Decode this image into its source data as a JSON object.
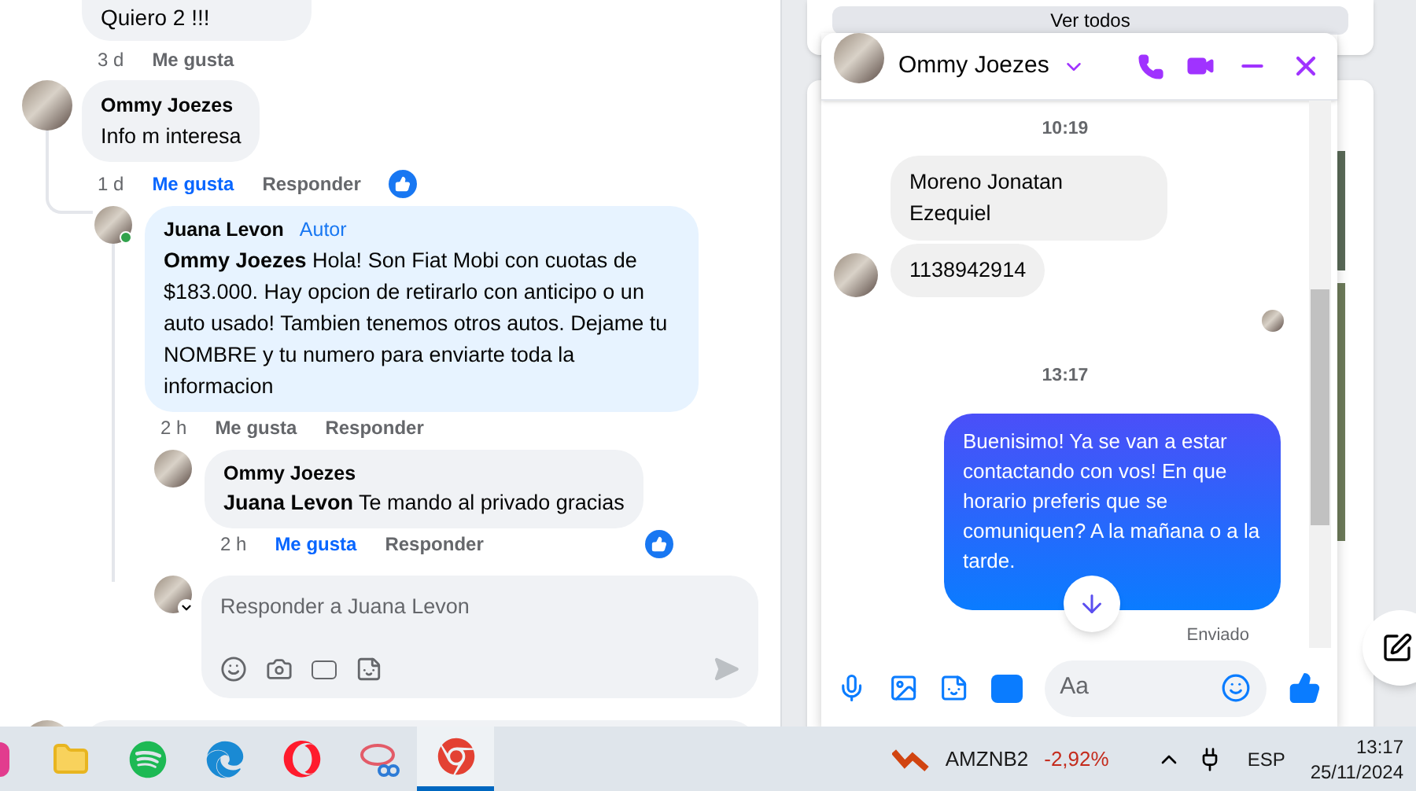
{
  "comment_thread": {
    "previous_comment": {
      "text": "Quiero 2 !!!",
      "time": "3 d",
      "like_label": "Me gusta",
      "liked": false
    },
    "comment": {
      "author": "Ommy Joezes",
      "text": "Info m interesa",
      "time": "1 d",
      "like_label": "Me gusta",
      "liked": true,
      "reply_label": "Responder",
      "has_reaction": true,
      "children": [
        {
          "author": "Juana Levon",
          "badge": "Autor",
          "online": true,
          "text": "**Ommy Joezes** Hola! Son Fiat Mobi con cuotas de $183.000. Hay opcion de retirarlo con anticipo o un auto usado! Tambien tenemos otros autos. Dejame tu NOMBRE y tu numero para enviarte toda la informacion",
          "time": "2 h",
          "like_label": "Me gusta",
          "liked": false,
          "reply_label": "Responder",
          "has_reaction": false,
          "highlighted": true
        },
        {
          "author": "Ommy Joezes",
          "text": "**Juana Levon** Te mando al privado gracias",
          "time": "2 h",
          "like_label": "Me gusta",
          "liked": true,
          "reply_label": "Responder",
          "has_reaction": true,
          "highlighted": false
        }
      ]
    },
    "reply_box": {
      "placeholder": "Responder a Juana Levon"
    }
  },
  "side_panel": {
    "see_all_button": "Ver todos"
  },
  "chat": {
    "contact": "Ommy Joezes",
    "messages": [
      {
        "kind": "time",
        "text": "10:19"
      },
      {
        "kind": "incoming",
        "text": "Moreno Jonatan Ezequiel",
        "show_avatar": false
      },
      {
        "kind": "incoming",
        "text": "1138942914",
        "show_avatar": true
      },
      {
        "kind": "seen"
      },
      {
        "kind": "time",
        "text": "13:17"
      },
      {
        "kind": "outgoing",
        "text": "Buenisimo! Ya se van a estar contactando con vos! En que horario preferis que se comuniquen? A la mañana o a la tarde."
      },
      {
        "kind": "status",
        "text": "Enviado"
      }
    ],
    "input_placeholder": "Aa"
  },
  "taskbar": {
    "apps": [
      {
        "kind": "pink",
        "active": false
      },
      {
        "kind": "folder",
        "active": false
      },
      {
        "kind": "music",
        "active": false
      },
      {
        "kind": "edge",
        "active": false
      },
      {
        "kind": "opera",
        "active": false
      },
      {
        "kind": "snip",
        "active": false
      },
      {
        "kind": "chrome",
        "active": true
      }
    ],
    "ticker": {
      "symbol": "AMZNB2",
      "change": "-2,92%"
    },
    "language": "ESP",
    "time": "13:17",
    "date": "25/11/2024"
  }
}
